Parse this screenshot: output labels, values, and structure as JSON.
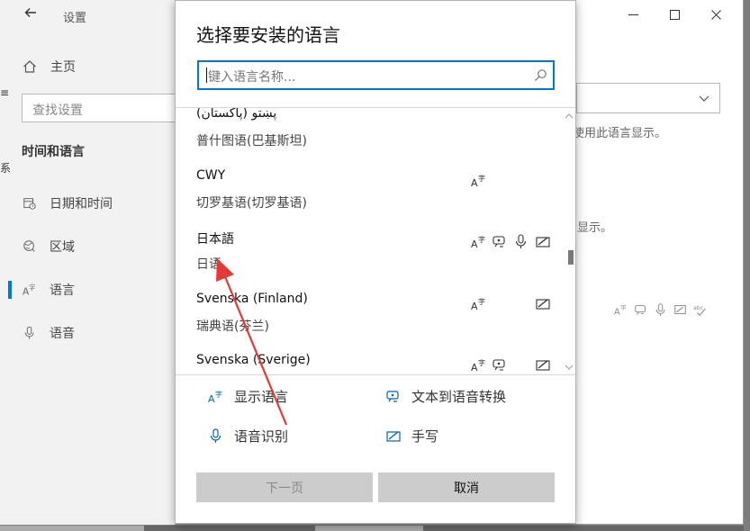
{
  "settings": {
    "app_title": "设置",
    "home_label": "主页",
    "search_placeholder": "查找设置",
    "section_title": "时间和语言",
    "nav": [
      {
        "label": "日期和时间",
        "icon": "date-time-icon"
      },
      {
        "label": "区域",
        "icon": "region-icon"
      },
      {
        "label": "语言",
        "icon": "language-icon"
      },
      {
        "label": "语音",
        "icon": "microphone-icon"
      }
    ],
    "bg_text_1": "使用此语言显示。",
    "bg_text_2": "示显示。",
    "stray_left_1": "≡",
    "stray_left_2": "系"
  },
  "dialog": {
    "title": "选择要安装的语言",
    "search_placeholder": "键入语言名称...",
    "languages": [
      {
        "name": "پښتو (پاکستان)",
        "sub": "普什图语(巴基斯坦)",
        "features": []
      },
      {
        "name": "CWY",
        "sub": "切罗基语(切罗基语)",
        "features": [
          "display"
        ]
      },
      {
        "name": "日本語",
        "sub": "日语",
        "features": [
          "display",
          "tts",
          "speech",
          "handwriting"
        ]
      },
      {
        "name": "Svenska (Finland)",
        "sub": "瑞典语(芬兰)",
        "features": [
          "display",
          "handwriting"
        ]
      },
      {
        "name": "Svenska (Sverige)",
        "sub": "",
        "features": [
          "display",
          "tts",
          "handwriting"
        ]
      }
    ],
    "legend": {
      "display": "显示语言",
      "tts": "文本到语音转换",
      "speech": "语音识别",
      "handwriting": "手写"
    },
    "buttons": {
      "next": "下一页",
      "cancel": "取消"
    }
  },
  "colors": {
    "accent": "#0078d7",
    "annotation": "#e53935"
  }
}
